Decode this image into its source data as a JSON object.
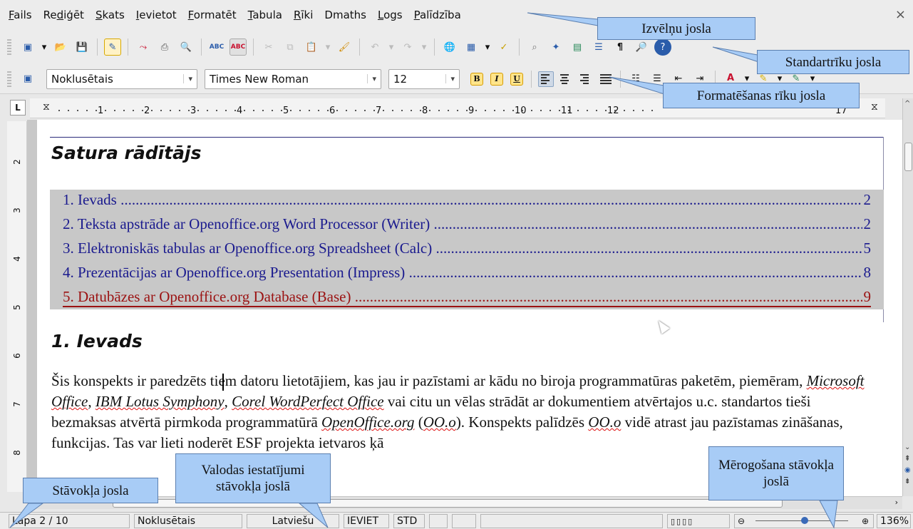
{
  "menu": [
    "Fails",
    "Rediģēt",
    "Skats",
    "Ievietot",
    "Formatēt",
    "Tabula",
    "Rīki",
    "Dmaths",
    "Logs",
    "Palīdzība"
  ],
  "formatting": {
    "style": "Noklusētais",
    "font": "Times New Roman",
    "size": "12",
    "bold": "B",
    "italic": "I",
    "underline": "U"
  },
  "ruler": {
    "corner": "L",
    "h_ticks": [
      "1",
      "2",
      "3",
      "4",
      "5",
      "6",
      "7",
      "8",
      "9",
      "10",
      "11",
      "12",
      "17"
    ],
    "v_ticks": [
      "2",
      "3",
      "4",
      "5",
      "6",
      "7",
      "8"
    ]
  },
  "document": {
    "toc_title": "Satura rādītājs",
    "toc": [
      {
        "text": "1. Ievads",
        "page": "2"
      },
      {
        "text": "2. Teksta apstrāde ar Openoffice.org Word Processor (Writer)",
        "page": "2"
      },
      {
        "text": "3. Elektroniskās tabulas ar Openoffice.org Spreadsheet (Calc)",
        "page": "5"
      },
      {
        "text": "4. Prezentācijas ar Openoffice.org Presentation (Impress)",
        "page": "8"
      },
      {
        "text": "5. Datubāzes ar Openoffice.org Database (Base)",
        "page": "9"
      }
    ],
    "heading": "1. Ievads",
    "body": {
      "p1": "Šis konspekts ir paredzēts tiem datoru lietotājiem, kas jau ir pazīstami ar kādu no biroja programmatūras paketēm, piemēram, ",
      "i1": "Microsoft Office",
      "c1": ", ",
      "i2": "IBM Lotus Symphony",
      "c2": ", ",
      "i3": "Corel WordPerfect Office",
      "p2": " vai citu un vēlas strādāt ar dokumentiem atvērtajos u.c. standartos tieši bezmaksas atvērtā pirmkoda programmatūrā ",
      "i4": "OpenOffice.org",
      "p3": " (",
      "i5": "OO.o",
      "p4": "). Konspekts palīdzēs ",
      "i6": "OO.o",
      "p5": " vidē atrast jau pazīstamas zināšanas, funkcijas. Tas var lieti noderēt ESF projekta ietvaros ķā"
    }
  },
  "status": {
    "page": "Lapa 2 / 10",
    "style": "Noklusētais",
    "language": "Latviešu",
    "insert": "IEVIET",
    "selection": "STD",
    "zoom": "136%"
  },
  "callouts": {
    "menubar": "Izvēlņu josla",
    "standard": "Standartrīku josla",
    "formatting": "Formatēšanas rīku josla",
    "statusbar": "Stāvokļa josla",
    "language": "Valodas iestatījumi stāvokļa joslā",
    "zoom": "Mērogošana stāvokļa joslā"
  }
}
